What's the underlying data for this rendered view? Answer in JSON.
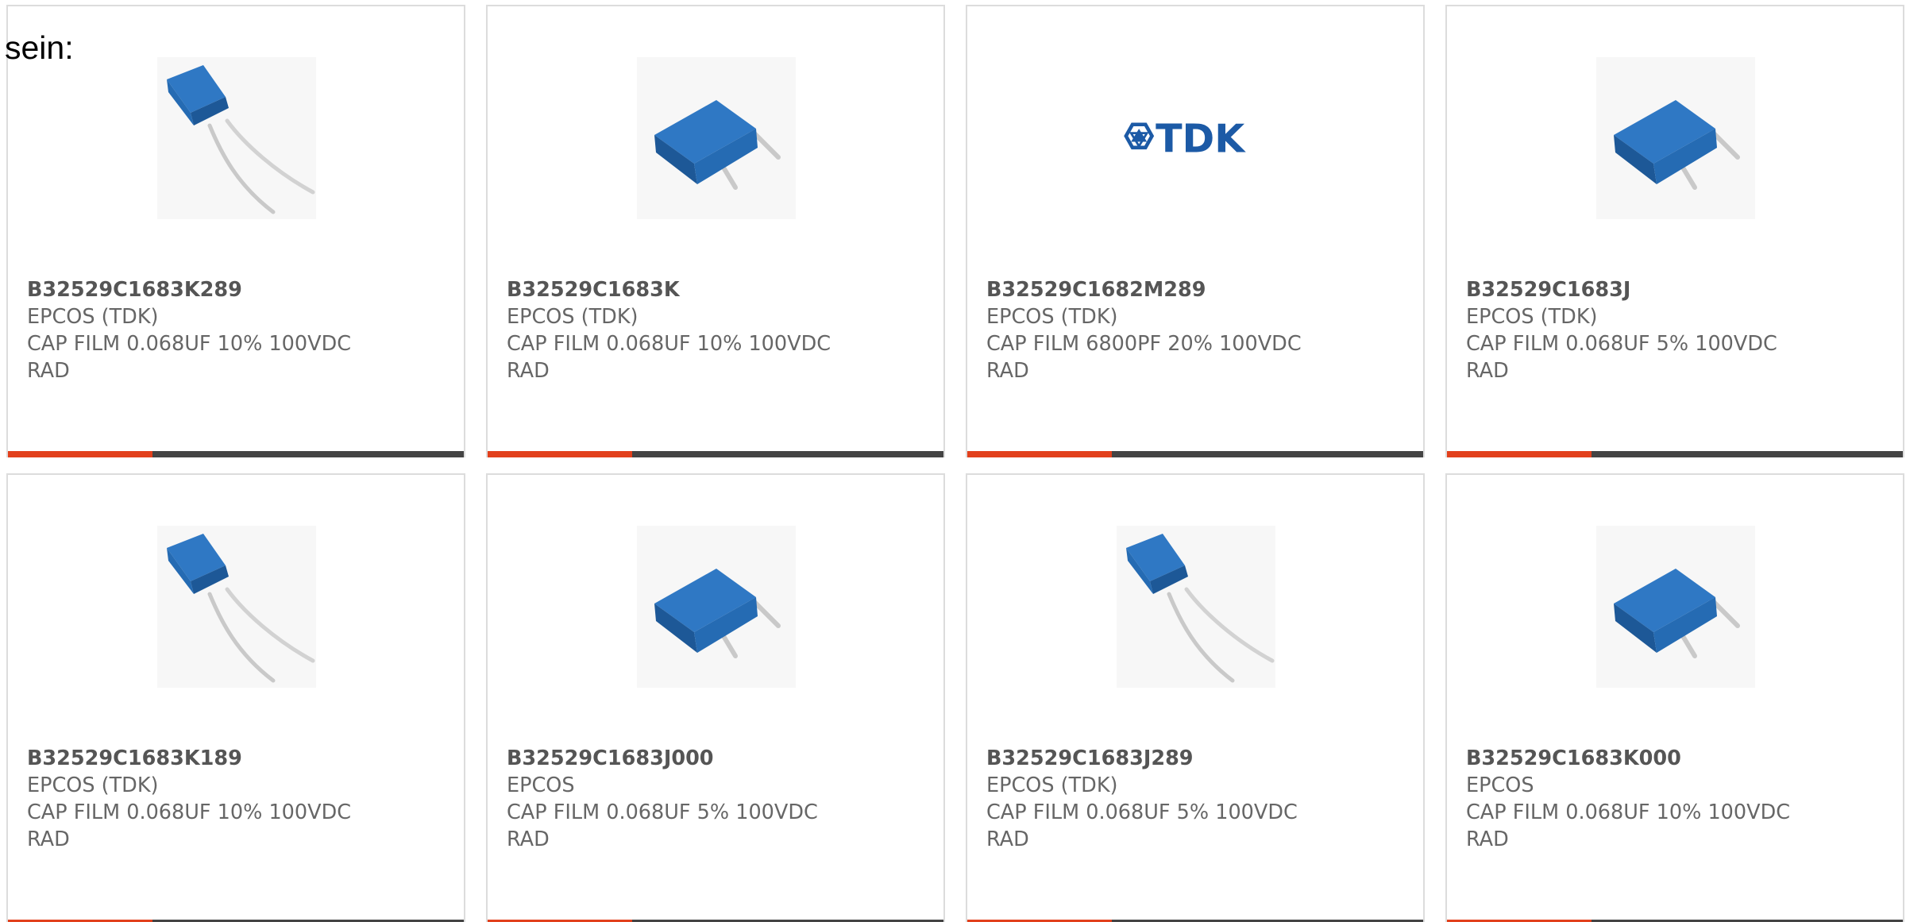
{
  "intro_text": "sein:",
  "colors": {
    "accent": "#e2401c",
    "bar": "#444444",
    "capacitor_blue": "#2f78c4",
    "tdk_blue": "#1c5aa6"
  },
  "products": [
    {
      "part_number": "B32529C1683K289",
      "manufacturer": "EPCOS (TDK)",
      "desc_line1": "CAP FILM 0.068UF 10% 100VDC",
      "desc_line2": "RAD",
      "image": "capacitor-angled-long-leads-image"
    },
    {
      "part_number": "B32529C1683K",
      "manufacturer": "EPCOS (TDK)",
      "desc_line1": "CAP FILM 0.068UF 10% 100VDC",
      "desc_line2": "RAD",
      "image": "capacitor-box-short-leads-image"
    },
    {
      "part_number": "B32529C1682M289",
      "manufacturer": "EPCOS (TDK)",
      "desc_line1": "CAP FILM 6800PF 20% 100VDC",
      "desc_line2": "RAD",
      "image": "tdk-logo-image",
      "logo_text": "TDK"
    },
    {
      "part_number": "B32529C1683J",
      "manufacturer": "EPCOS (TDK)",
      "desc_line1": "CAP FILM 0.068UF 5% 100VDC",
      "desc_line2": "RAD",
      "image": "capacitor-box-short-leads-image"
    },
    {
      "part_number": "B32529C1683K189",
      "manufacturer": "EPCOS (TDK)",
      "desc_line1": "CAP FILM 0.068UF 10% 100VDC",
      "desc_line2": "RAD",
      "image": "capacitor-angled-long-leads-image"
    },
    {
      "part_number": "B32529C1683J000",
      "manufacturer": "EPCOS",
      "desc_line1": "CAP FILM 0.068UF 5% 100VDC",
      "desc_line2": "RAD",
      "image": "capacitor-box-short-leads-image"
    },
    {
      "part_number": "B32529C1683J289",
      "manufacturer": "EPCOS (TDK)",
      "desc_line1": "CAP FILM 0.068UF 5% 100VDC",
      "desc_line2": "RAD",
      "image": "capacitor-angled-long-leads-image"
    },
    {
      "part_number": "B32529C1683K000",
      "manufacturer": "EPCOS",
      "desc_line1": "CAP FILM 0.068UF 10% 100VDC",
      "desc_line2": "RAD",
      "image": "capacitor-box-short-leads-image"
    }
  ]
}
